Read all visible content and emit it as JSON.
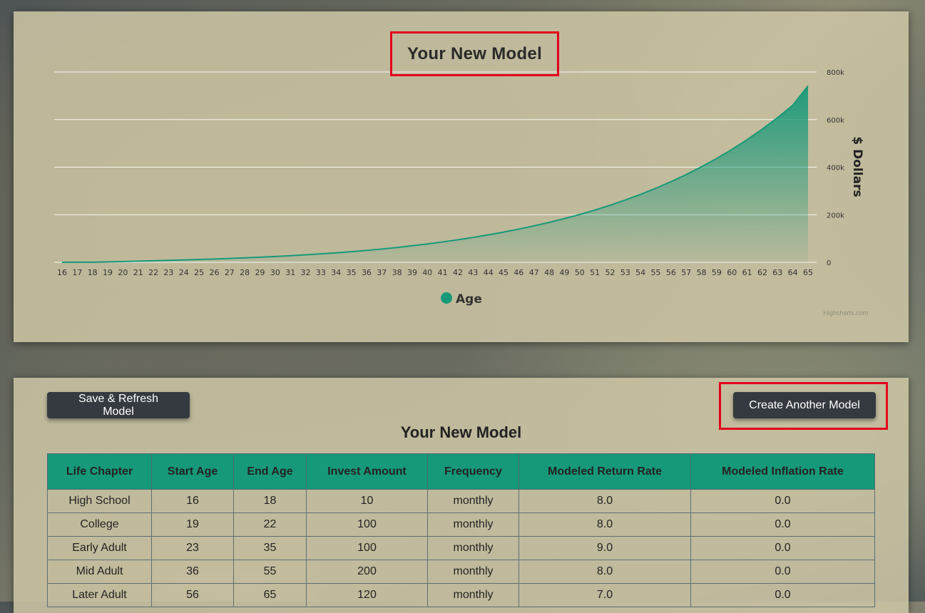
{
  "chart": {
    "title": "Your New Model",
    "credits": "Highcharts.com"
  },
  "chart_data": {
    "type": "area",
    "title": "Your New Model",
    "ylabel": "$ Dollars",
    "ylim": [
      0,
      800000
    ],
    "y_ticks": [
      0,
      200000,
      400000,
      600000,
      800000
    ],
    "y_tick_labels": [
      "0",
      "200k",
      "400k",
      "600k",
      "800k"
    ],
    "y_axis_side": "right",
    "grid": true,
    "legend": "bottom-center",
    "color": "#169979",
    "series": [
      {
        "name": "Age",
        "x": [
          16,
          17,
          18,
          19,
          20,
          21,
          22,
          23,
          24,
          25,
          26,
          27,
          28,
          29,
          30,
          31,
          32,
          33,
          34,
          35,
          36,
          37,
          38,
          39,
          40,
          41,
          42,
          43,
          44,
          45,
          46,
          47,
          48,
          49,
          50,
          51,
          52,
          53,
          54,
          55,
          56,
          57,
          58,
          59,
          60,
          61,
          62,
          63,
          64,
          65
        ],
        "y": [
          120,
          250,
          400,
          1700,
          3100,
          4700,
          6400,
          8100,
          9900,
          11800,
          13900,
          16200,
          18700,
          21400,
          24400,
          27800,
          31400,
          35400,
          39800,
          44600,
          50000,
          55900,
          62300,
          69500,
          77200,
          85600,
          94700,
          104600,
          115300,
          126900,
          139500,
          153100,
          167800,
          183800,
          201000,
          219700,
          240000,
          261900,
          285600,
          311200,
          339000,
          369000,
          401400,
          436500,
          474500,
          515600,
          560100,
          608200,
          660300,
          742000
        ]
      }
    ]
  },
  "table": {
    "save_label": "Save & Refresh Model",
    "create_label": "Create Another Model",
    "title": "Your New Model",
    "headers": [
      "Life Chapter",
      "Start Age",
      "End Age",
      "Invest Amount",
      "Frequency",
      "Modeled Return Rate",
      "Modeled Inflation Rate"
    ],
    "rows": [
      [
        "High School",
        "16",
        "18",
        "10",
        "monthly",
        "8.0",
        "0.0"
      ],
      [
        "College",
        "19",
        "22",
        "100",
        "monthly",
        "8.0",
        "0.0"
      ],
      [
        "Early Adult",
        "23",
        "35",
        "100",
        "monthly",
        "9.0",
        "0.0"
      ],
      [
        "Mid Adult",
        "36",
        "55",
        "200",
        "monthly",
        "8.0",
        "0.0"
      ],
      [
        "Later Adult",
        "56",
        "65",
        "120",
        "monthly",
        "7.0",
        "0.0"
      ]
    ]
  }
}
